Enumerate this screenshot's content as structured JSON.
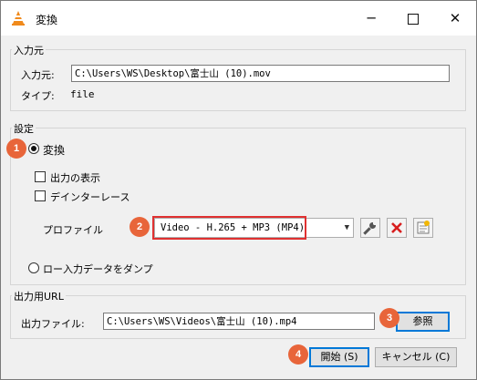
{
  "window": {
    "title": "変換"
  },
  "source": {
    "group_title": "入力元",
    "source_label": "入力元:",
    "source_value": "C:\\Users\\WS\\Desktop\\富士山 (10).mov",
    "type_label": "タイプ:",
    "type_value": "file"
  },
  "settings": {
    "group_title": "設定",
    "convert_label": "変換",
    "convert_selected": true,
    "show_output_label": "出力の表示",
    "deinterlace_label": "デインターレース",
    "profile_label": "プロファイル",
    "profile_value": "Video - H.265 + MP3 (MP4)",
    "dump_label": "ロー入力データをダンプ"
  },
  "output": {
    "group_title": "出力用URL",
    "file_label": "出力ファイル:",
    "file_value": "C:\\Users\\WS\\Videos\\富士山 (10).mp4",
    "browse_label": "参照"
  },
  "buttons": {
    "start_label": "開始 (S)",
    "cancel_label": "キャンセル (C)"
  },
  "badges": {
    "b1": "1",
    "b2": "2",
    "b3": "3",
    "b4": "4"
  },
  "colors": {
    "badge": "#e8653a",
    "highlight": "#e03131",
    "focus": "#0078d7"
  }
}
